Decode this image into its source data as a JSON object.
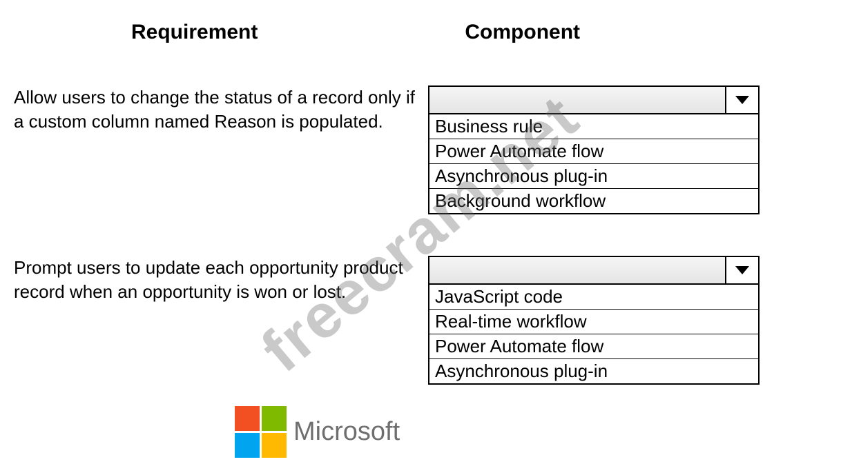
{
  "headers": {
    "requirement": "Requirement",
    "component": "Component"
  },
  "rows": [
    {
      "requirement": "Allow users to change the status of a record only if a custom column named Reason is populated.",
      "options": [
        "Business rule",
        "Power Automate flow",
        "Asynchronous plug-in",
        "Background workflow"
      ]
    },
    {
      "requirement": "Prompt users to update each opportunity product record when an opportunity is won or lost.",
      "options": [
        "JavaScript code",
        "Real-time workflow",
        "Power Automate flow",
        "Asynchronous plug-in"
      ]
    }
  ],
  "watermark": "freecram.net",
  "logo_text": "Microsoft"
}
